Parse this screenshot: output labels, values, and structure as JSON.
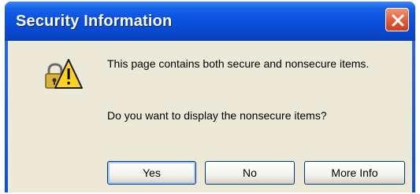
{
  "window": {
    "title": "Security Information",
    "close_icon": "close-icon"
  },
  "dialog": {
    "icon": "warning-lock-icon",
    "message_line1": "This page contains both secure and nonsecure items.",
    "message_line2": "Do you want to display the nonsecure items?"
  },
  "buttons": {
    "yes_label": "Yes",
    "no_label": "No",
    "more_info_label": "More Info"
  },
  "colors": {
    "titlebar": "#0a52e0",
    "close_button": "#e2603c",
    "client_background": "#ece9d8",
    "button_border": "#003c74"
  }
}
